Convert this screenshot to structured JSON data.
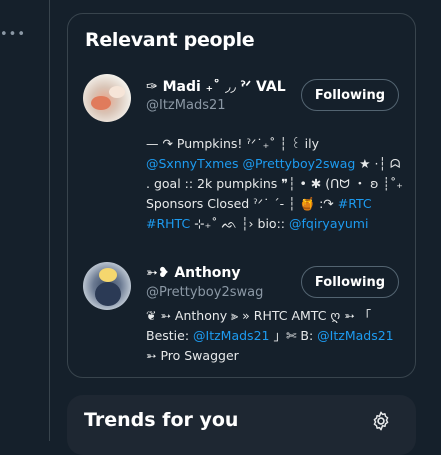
{
  "left_rail": {
    "more_icon": "more-dots-icon",
    "more_glyph": "•••"
  },
  "relevant_people": {
    "title": "Relevant people",
    "people": [
      {
        "name": "✑ Madi ₊˚ ◞◞ ˀᐟ VAL",
        "handle": "@ItzMads21",
        "button": "Following",
        "bio": [
          {
            "t": "— ↷ Pumpkins! ˀᐟ˙₊˚ ┆ ꒰ ily ",
            "link": false
          },
          {
            "t": "@SxnnyTxmes",
            "link": true
          },
          {
            "t": " ",
            "link": false
          },
          {
            "t": "@Prettyboy2swag",
            "link": true
          },
          {
            "t": " ★ ·┆ ᗣ . goal :: 2k pumpkins ❞┆ • ✱ (ᑎᗢ ・ ʚ ┊˚₊ Sponsors Closed ˀᐟ˙ ˊ- ┆ 🍯 :↷ ",
            "link": false
          },
          {
            "t": "#RTC",
            "link": true
          },
          {
            "t": " ",
            "link": false
          },
          {
            "t": "#RHTC",
            "link": true
          },
          {
            "t": " ⊹₊˚ ᨒ ┆› bio:: ",
            "link": false
          },
          {
            "t": "@fqiryayumi",
            "link": true
          }
        ]
      },
      {
        "name": "➳❥ Anthony",
        "handle": "@Prettyboy2swag",
        "button": "Following",
        "bio": [
          {
            "t": "❦ ➳ Anthony ⫸ » RHTC AMTC ღ ➳ 「 Bestie: ",
            "link": false
          },
          {
            "t": "@ItzMads21",
            "link": true
          },
          {
            "t": " 」✄ B: ",
            "link": false
          },
          {
            "t": "@ItzMads21",
            "link": true
          },
          {
            "t": " ➳ Pro Swagger",
            "link": false
          }
        ]
      }
    ]
  },
  "trends": {
    "title": "Trends for you",
    "settings_icon": "gear-icon"
  },
  "colors": {
    "background": "#15202b",
    "link": "#1d9bf0",
    "muted": "#8b98a5",
    "border": "#38444d"
  }
}
